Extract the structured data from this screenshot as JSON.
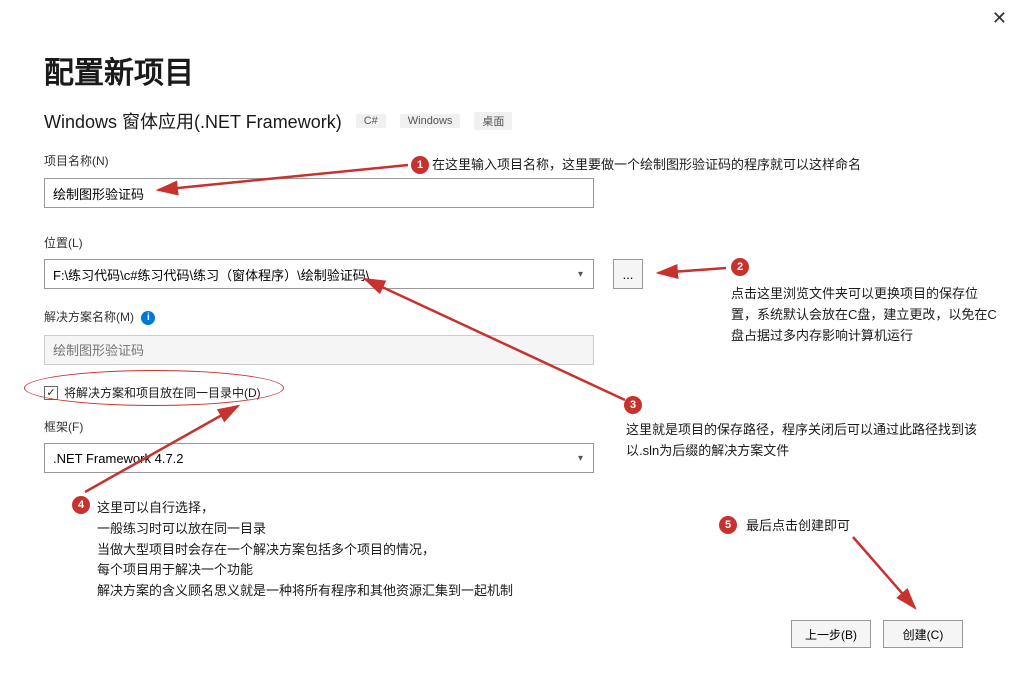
{
  "close": "✕",
  "title": "配置新项目",
  "subtitle": "Windows 窗体应用(.NET Framework)",
  "tags": {
    "t1": "C#",
    "t2": "Windows",
    "t3": "桌面"
  },
  "sections": {
    "projectName": {
      "label": "项目名称(N)",
      "value": "绘制图形验证码"
    },
    "location": {
      "label": "位置(L)",
      "value": "F:\\练习代码\\c#练习代码\\练习（窗体程序）\\绘制验证码\\",
      "browse": "..."
    },
    "solution": {
      "label": "解决方案名称(M)",
      "placeholder": "绘制图形验证码"
    },
    "checkbox": {
      "label": "将解决方案和项目放在同一目录中(D)",
      "checked": "✓"
    },
    "framework": {
      "label": "框架(F)",
      "value": ".NET Framework 4.7.2"
    }
  },
  "buttons": {
    "back": "上一步(B)",
    "create": "创建(C)"
  },
  "anno": {
    "n1": "1",
    "t1": "在这里输入项目名称，这里要做一个绘制图形验证码的程序就可以这样命名",
    "n2": "2",
    "t2": "点击这里浏览文件夹可以更换项目的保存位置，系统默认会放在C盘，建立更改，以免在C盘占据过多内存影响计算机运行",
    "n3": "3",
    "t3": "这里就是项目的保存路径，程序关闭后可以通过此路径找到该以.sln为后缀的解决方案文件",
    "n4": "4",
    "t4": "这里可以自行选择，\n一般练习时可以放在同一目录\n当做大型项目时会存在一个解决方案包括多个项目的情况，\n每个项目用于解决一个功能\n解决方案的含义顾名思义就是一种将所有程序和其他资源汇集到一起机制",
    "n5": "5",
    "t5": "最后点击创建即可"
  }
}
